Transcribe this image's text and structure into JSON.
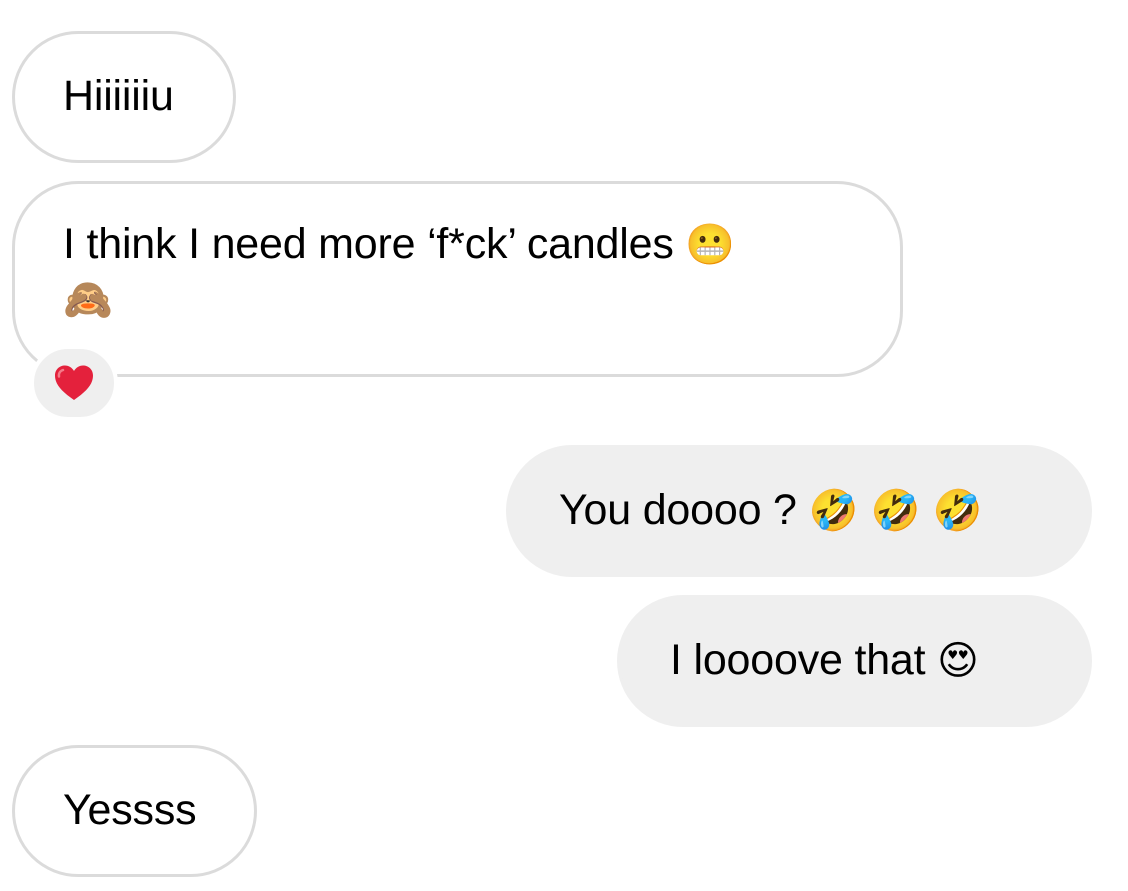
{
  "conversation": {
    "messages": [
      {
        "id": "m1",
        "direction": "incoming",
        "text": "Hiiiiiiu",
        "emoji": ""
      },
      {
        "id": "m2",
        "direction": "incoming",
        "text": "I think I need more ‘f*ck’ candles",
        "emoji": "😬",
        "emoji_line2": "🙈",
        "reaction": "❤️"
      },
      {
        "id": "m3",
        "direction": "outgoing",
        "text": "You doooo ?",
        "emoji": "🤣 🤣 🤣"
      },
      {
        "id": "m4",
        "direction": "outgoing",
        "text": "I loooove that",
        "emoji": "😍"
      },
      {
        "id": "m5",
        "direction": "incoming",
        "text": "Yessss",
        "emoji": ""
      }
    ]
  },
  "colors": {
    "incoming_bubble_border": "#dbdbdb",
    "outgoing_bubble_bg": "#efefef",
    "reaction_bg": "#efefef",
    "heart": "#e4213c",
    "text": "#000000"
  },
  "icons": {
    "reaction": "heart-icon"
  }
}
